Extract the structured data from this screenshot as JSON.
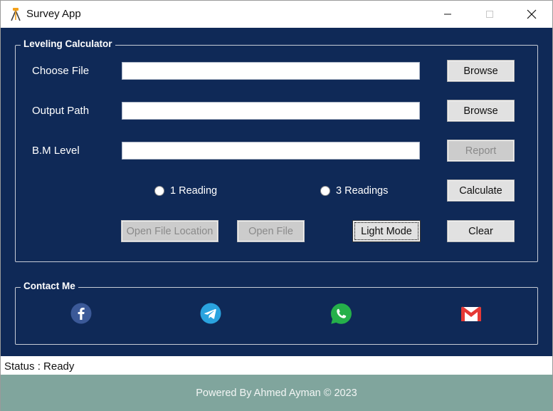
{
  "window": {
    "title": "Survey App",
    "icon": "surveyor-tripod-icon"
  },
  "leveling": {
    "group_title": "Leveling Calculator",
    "choose_file_label": "Choose File",
    "choose_file_value": "",
    "output_path_label": "Output Path",
    "output_path_value": "",
    "bm_level_label": "B.M Level",
    "bm_level_value": "",
    "browse1_label": "Browse",
    "browse2_label": "Browse",
    "report_label": "Report",
    "calculate_label": "Calculate",
    "radio_one_label": "1 Reading",
    "radio_three_label": "3 Readings",
    "open_location_label": "Open File Location",
    "open_file_label": "Open File",
    "light_mode_label": "Light Mode",
    "clear_label": "Clear"
  },
  "contact": {
    "group_title": "Contact Me",
    "icons": [
      "facebook-icon",
      "telegram-icon",
      "whatsapp-icon",
      "gmail-icon"
    ],
    "colors": {
      "facebook": "#3b5998",
      "telegram": "#2aa3df",
      "whatsapp": "#25b04a",
      "gmail": "#e53935"
    }
  },
  "status": {
    "text": "Status : Ready"
  },
  "footer": {
    "text": "Powered By Ahmed Ayman © 2023"
  },
  "theme": {
    "background": "#0f2957",
    "footer": "#80a59d"
  }
}
